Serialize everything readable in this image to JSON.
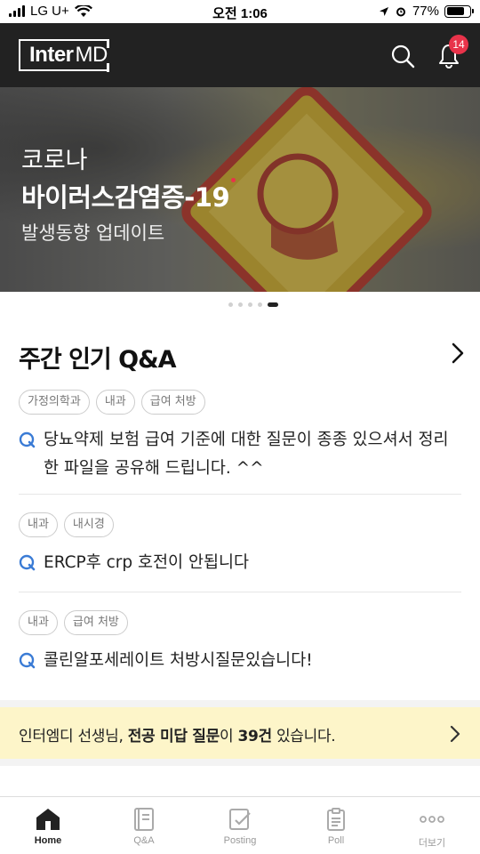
{
  "status_bar": {
    "carrier": "LG U+",
    "time": "오전 1:06",
    "battery": "77%",
    "battery_level": 0.77
  },
  "header": {
    "logo_inter": "Inter",
    "logo_md": "MD",
    "notification_count": "14"
  },
  "banner": {
    "line1": "코로나",
    "line2": "바이러스감염증-19",
    "line3": "발생동향 업데이트",
    "slide_count": 5,
    "active_slide": 5
  },
  "weekly_qa": {
    "title": "주간 인기 Q&A",
    "items": [
      {
        "tags": [
          "가정의학과",
          "내과",
          "급여 처방"
        ],
        "question": "당뇨약제 보험 급여 기준에 대한 질문이 종종 있으셔서 정리한 파일을 공유해 드립니다. ^^"
      },
      {
        "tags": [
          "내과",
          "내시경"
        ],
        "question": "ERCP후 crp 호전이 안됩니다"
      },
      {
        "tags": [
          "내과",
          "급여 처방"
        ],
        "question": "콜린알포세레이트 처방시질문있습니다!"
      }
    ]
  },
  "notice": {
    "prefix": "인터엠디 선생님, ",
    "bold1": "전공 미답 질문",
    "mid": "이 ",
    "bold2": "39건",
    "suffix": " 있습니다."
  },
  "tabbar": {
    "tabs": [
      {
        "label": "Home",
        "icon": "home-icon",
        "active": true
      },
      {
        "label": "Q&A",
        "icon": "book-icon",
        "active": false
      },
      {
        "label": "Posting",
        "icon": "edit-icon",
        "active": false
      },
      {
        "label": "Poll",
        "icon": "clipboard-icon",
        "active": false
      },
      {
        "label": "더보기",
        "icon": "more-icon",
        "active": false
      }
    ]
  },
  "colors": {
    "header_bg": "#222222",
    "accent_blue": "#3a7bd5",
    "badge_red": "#e8334a",
    "notice_bg": "#fdf5c9"
  }
}
